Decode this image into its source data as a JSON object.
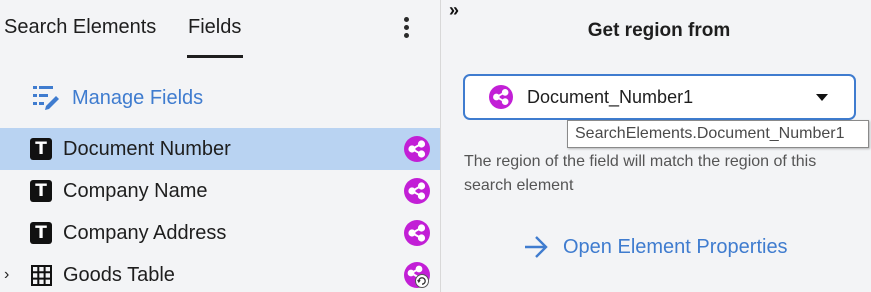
{
  "tabs": {
    "search_elements": "Search Elements",
    "fields": "Fields",
    "active": "Fields"
  },
  "manage_fields": {
    "label": "Manage Fields",
    "icon": "edit-list-icon"
  },
  "fields": [
    {
      "label": "Document Number",
      "icon": "text-field-icon",
      "badge": "share-icon",
      "selected": true
    },
    {
      "label": "Company Name",
      "icon": "text-field-icon",
      "badge": "share-icon",
      "selected": false
    },
    {
      "label": "Company Address",
      "icon": "text-field-icon",
      "badge": "share-icon",
      "selected": false
    },
    {
      "label": "Goods Table",
      "icon": "table-icon",
      "badge": "share-refresh-icon",
      "selected": false,
      "expandable": true
    }
  ],
  "panel": {
    "collapse_glyph": "»",
    "title": "Get region from",
    "select": {
      "value": "Document_Number1",
      "icon": "share-icon"
    },
    "tooltip": "SearchElements.Document_Number1",
    "description": "The region of the field will match the region of this search element",
    "open_link": "Open Element Properties"
  },
  "colors": {
    "accent": "#3f7ccf",
    "badge": "#c21fd6",
    "selected_row": "#b9d3f2",
    "pane_bg": "#f3f4f6"
  }
}
